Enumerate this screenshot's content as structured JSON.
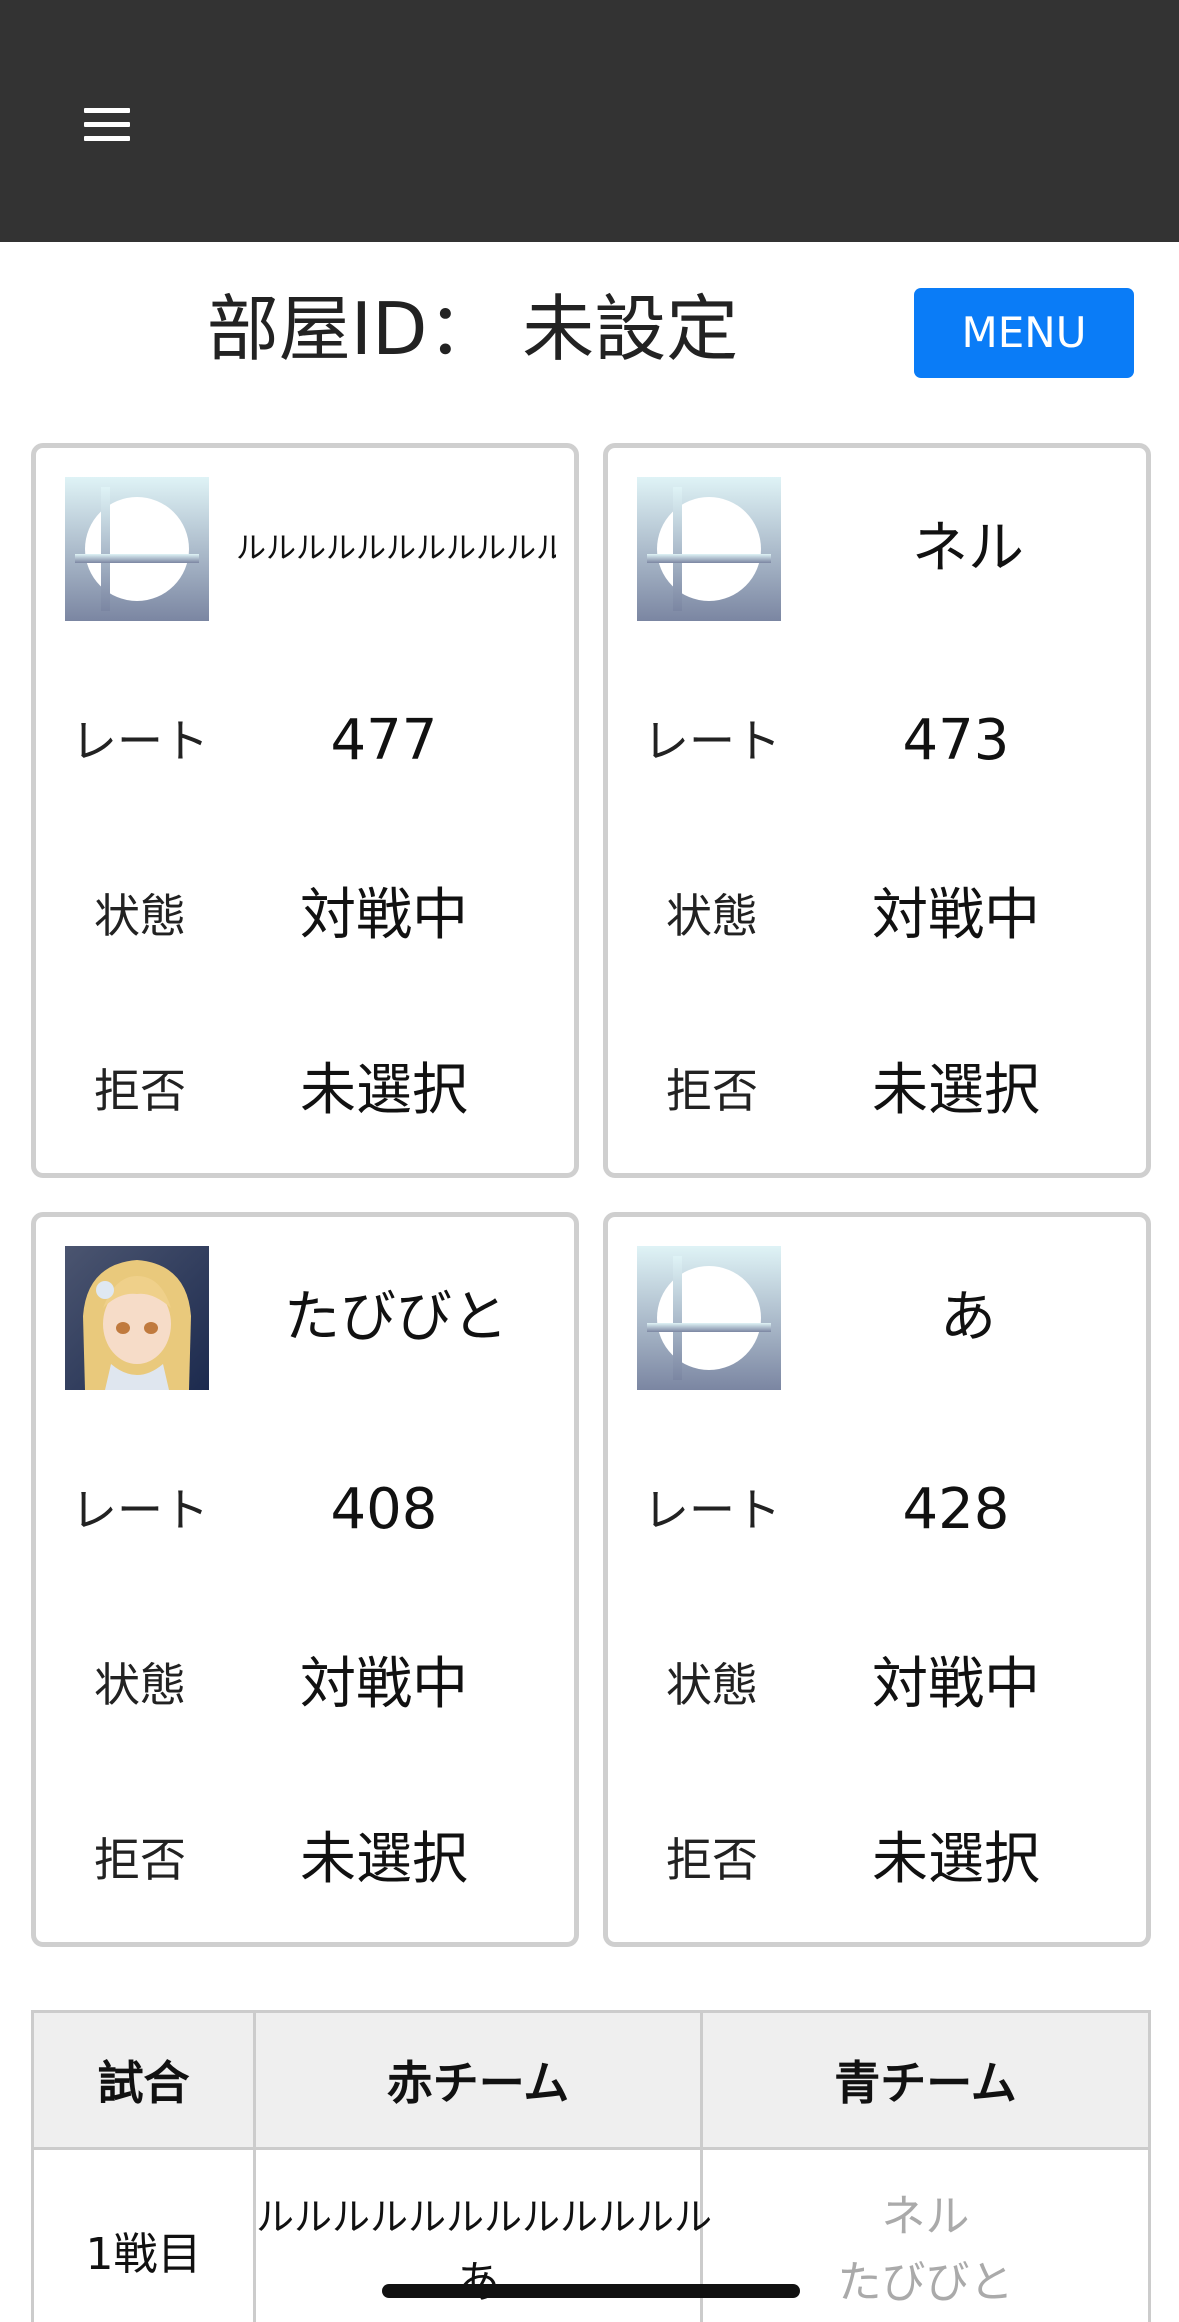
{
  "header": {
    "menu_icon": "hamburger-icon"
  },
  "room": {
    "label": "部屋ID：",
    "value": "未設定",
    "menu_button": "MENU"
  },
  "colors": {
    "topbar": "#333333",
    "menu_button": "#0a7cf7",
    "card_border": "#cfcfcf",
    "dim_text": "#aaaaaa"
  },
  "players": [
    {
      "avatar": "smash-logo-icon",
      "name": "ルルルルルルルルルルルル",
      "rate_label": "レート",
      "rate": "477",
      "state_label": "状態",
      "state": "対戦中",
      "refuse_label": "拒否",
      "refuse": "未選択"
    },
    {
      "avatar": "smash-logo-icon",
      "name": "ネル",
      "rate_label": "レート",
      "rate": "473",
      "state_label": "状態",
      "state": "対戦中",
      "refuse_label": "拒否",
      "refuse": "未選択"
    },
    {
      "avatar": "character-portrait",
      "name": "たびびと",
      "rate_label": "レート",
      "rate": "408",
      "state_label": "状態",
      "state": "対戦中",
      "refuse_label": "拒否",
      "refuse": "未選択"
    },
    {
      "avatar": "smash-logo-icon",
      "name": "あ",
      "rate_label": "レート",
      "rate": "428",
      "state_label": "状態",
      "state": "対戦中",
      "refuse_label": "拒否",
      "refuse": "未選択"
    }
  ],
  "matches": {
    "headers": [
      "試合",
      "赤チーム",
      "青チーム"
    ],
    "rows": [
      {
        "match": "1戦目",
        "red": [
          "ルルルルルルルルルルルル",
          "あ"
        ],
        "blue": [
          "ネル",
          "たびびと"
        ]
      }
    ]
  }
}
